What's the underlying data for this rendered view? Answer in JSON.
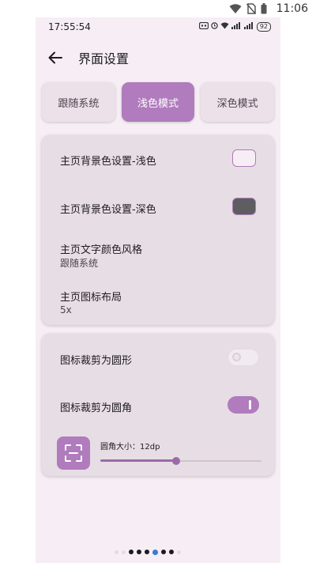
{
  "system": {
    "time": "11:06"
  },
  "app_status": {
    "time": "17:55:54",
    "battery": "92"
  },
  "header": {
    "title": "界面设置"
  },
  "modes": [
    {
      "label": "跟随系统",
      "active": false
    },
    {
      "label": "浅色模式",
      "active": true
    },
    {
      "label": "深色模式",
      "active": false
    }
  ],
  "card1": {
    "bg_light_label": "主页背景色设置-浅色",
    "bg_light_color": "#f6eef4",
    "bg_dark_label": "主页背景色设置-深色",
    "bg_dark_color": "#5e5d5f",
    "text_color_label": "主页文字颜色风格",
    "text_color_value": "跟随系统",
    "layout_label": "主页图标布局",
    "layout_value": "5x"
  },
  "card2": {
    "circle_label": "图标裁剪为圆形",
    "circle_on": false,
    "rounded_label": "图标裁剪为圆角",
    "rounded_on": true,
    "radius_label": "圆角大小：12dp",
    "radius_fraction": 0.47
  },
  "colors": {
    "accent": "#b07cbd",
    "surface": "#e7dde5",
    "background": "#f6eef4"
  }
}
